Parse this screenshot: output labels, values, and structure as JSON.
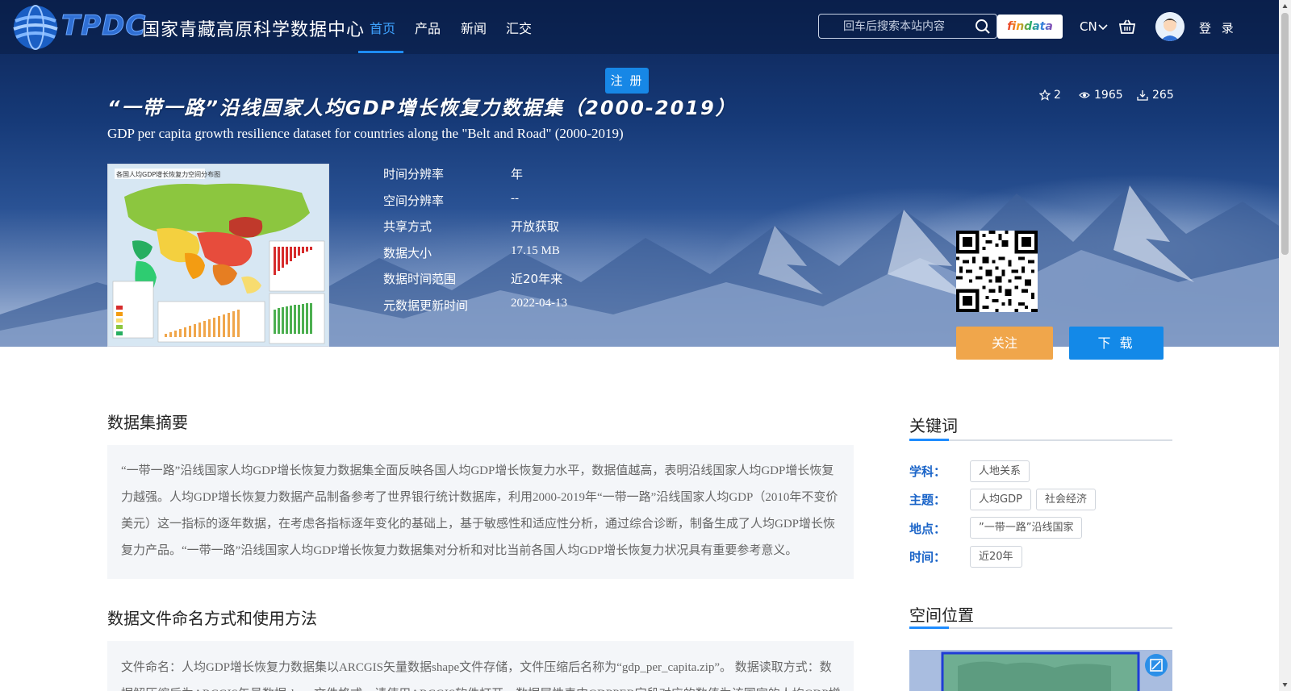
{
  "nav": {
    "logo_abbr": "TPDC",
    "logo_name": "国家青藏高原科学数据中心",
    "items": [
      {
        "label": "首页",
        "active": true
      },
      {
        "label": "产品",
        "active": false
      },
      {
        "label": "新闻",
        "active": false
      },
      {
        "label": "汇交",
        "active": false
      }
    ],
    "search_placeholder": "回车后搜索本站内容",
    "findata_label": "findata",
    "lang": "CN",
    "login": "登 录",
    "register": "注 册"
  },
  "dataset": {
    "title_cn": "“一带一路”沿线国家人均GDP增长恢复力数据集（2000-2019）",
    "title_en": "GDP per capita growth resilience dataset for countries along the \"Belt and Road\" (2000-2019)",
    "stats": {
      "stars": "2",
      "views": "1965",
      "downloads": "265"
    },
    "info": [
      {
        "label": "时间分辨率",
        "value": "年"
      },
      {
        "label": "空间分辨率",
        "value": "--"
      },
      {
        "label": "共享方式",
        "value": "开放获取"
      },
      {
        "label": "数据大小",
        "value": "17.15 MB"
      },
      {
        "label": "数据时间范围",
        "value": "近20年来"
      },
      {
        "label": "元数据更新时间",
        "value": "2022-04-13"
      }
    ],
    "thumbnail_caption": "各国人均GDP增长恢复力空间分布图",
    "follow_label": "关注",
    "download_label": "下 载"
  },
  "abstract": {
    "heading": "数据集摘要",
    "text": "“一带一路”沿线国家人均GDP增长恢复力数据集全面反映各国人均GDP增长恢复力水平，数据值越高，表明沿线国家人均GDP增长恢复力越强。人均GDP增长恢复力数据产品制备参考了世界银行统计数据库，利用2000-2019年“一带一路”沿线国家人均GDP（2010年不变价美元）这一指标的逐年数据，在考虑各指标逐年变化的基础上，基于敏感性和适应性分析，通过综合诊断，制备生成了人均GDP增长恢复力产品。“一带一路”沿线国家人均GDP增长恢复力数据集对分析和对比当前各国人均GDP增长恢复力状况具有重要参考意义。"
  },
  "file_naming": {
    "heading": "数据文件命名方式和使用方法",
    "text": "文件命名：人均GDP增长恢复力数据集以ARCGIS矢量数据shape文件存储，文件压缩后名称为“gdp_per_capita.zip”。 数据读取方式：数据解压缩后为ARCGIS矢量数据shape文件格式，请使用ARCGIS软件打开，数据属性表中GDPPER字段对应的数值为该国家的人均GDP增长恢复力数据。"
  },
  "keywords": {
    "heading": "关键词",
    "rows": [
      {
        "label": "学科：",
        "tags": [
          "人地关系"
        ]
      },
      {
        "label": "主题：",
        "tags": [
          "人均GDP",
          "社会经济"
        ]
      },
      {
        "label": "地点：",
        "tags": [
          "”一带一路”沿线国家"
        ]
      },
      {
        "label": "时间：",
        "tags": [
          "近20年"
        ]
      }
    ]
  },
  "spatial": {
    "heading": "空间位置"
  },
  "colors": {
    "accent": "#1e8cff",
    "follow": "#f0a64b",
    "download": "#1389e8",
    "keyword_label": "#1a64c8"
  }
}
